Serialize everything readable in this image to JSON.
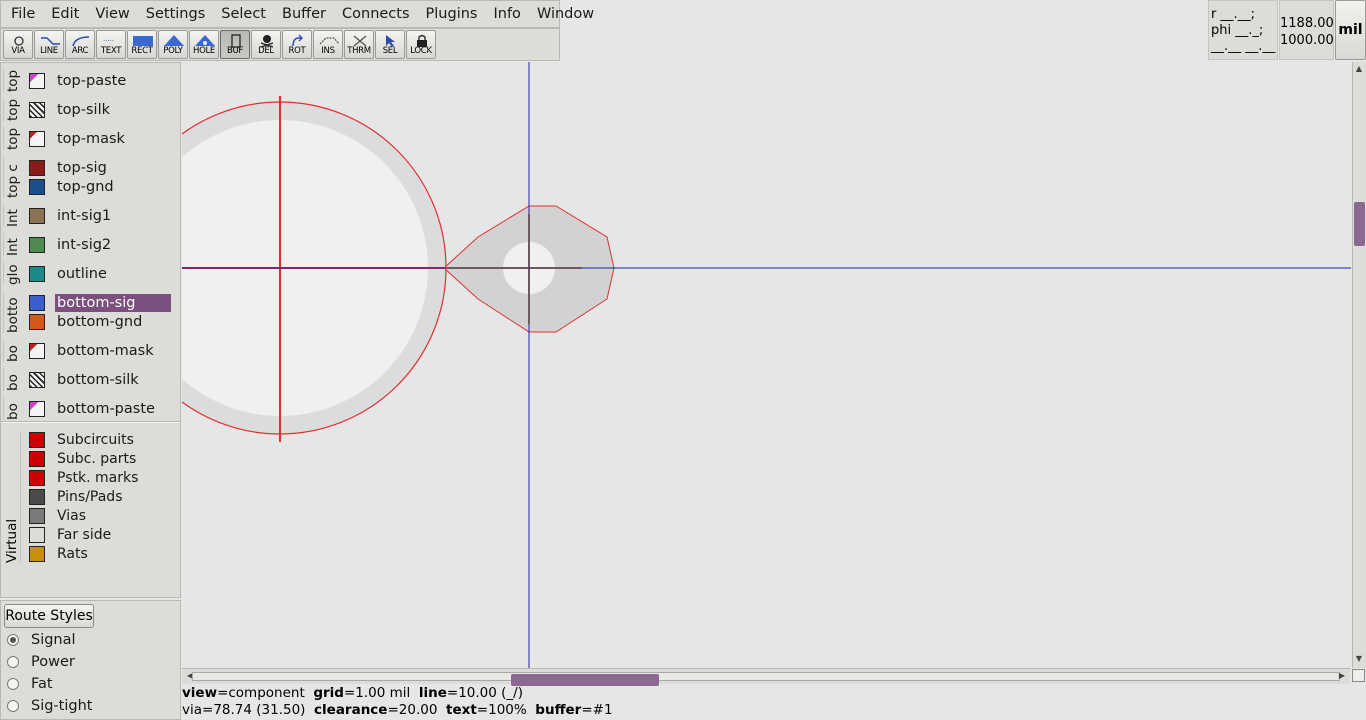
{
  "menubar": [
    "File",
    "Edit",
    "View",
    "Settings",
    "Select",
    "Buffer",
    "Connects",
    "Plugins",
    "Info",
    "Window"
  ],
  "toolbar": [
    {
      "label": "VIA",
      "icon": "via-icon",
      "active": false
    },
    {
      "label": "LINE",
      "icon": "line-icon",
      "active": false
    },
    {
      "label": "ARC",
      "icon": "arc-icon",
      "active": false
    },
    {
      "label": "TEXT",
      "icon": "text-icon",
      "active": false
    },
    {
      "label": "RECT",
      "icon": "rect-icon",
      "active": false
    },
    {
      "label": "POLY",
      "icon": "poly-icon",
      "active": false
    },
    {
      "label": "HOLE",
      "icon": "hole-icon",
      "active": false
    },
    {
      "label": "BUF",
      "icon": "buffer-icon",
      "active": true
    },
    {
      "label": "DEL",
      "icon": "delete-icon",
      "active": false
    },
    {
      "label": "ROT",
      "icon": "rotate-icon",
      "active": false
    },
    {
      "label": "INS",
      "icon": "insert-icon",
      "active": false
    },
    {
      "label": "THRM",
      "icon": "thermal-icon",
      "active": false
    },
    {
      "label": "SEL",
      "icon": "select-icon",
      "active": false
    },
    {
      "label": "LOCK",
      "icon": "lock-icon",
      "active": false
    }
  ],
  "readout": {
    "r_line": "r __.__;",
    "phi_line": "phi __._;",
    "blank_line": "__.__ __.__",
    "x": "1188.00",
    "y": "1000.00",
    "unit": "mil"
  },
  "layer_groups": [
    {
      "label": "top"
    },
    {
      "label": "top"
    },
    {
      "label": "top"
    },
    {
      "label": "top c"
    },
    {
      "label": "Int"
    },
    {
      "label": "Int"
    },
    {
      "label": "glo"
    },
    {
      "label": "botto"
    },
    {
      "label": "bo"
    },
    {
      "label": "bo"
    },
    {
      "label": "bo"
    }
  ],
  "layers": [
    {
      "name": "top-paste",
      "color": "paste"
    },
    {
      "name": "top-silk",
      "color": "hatch"
    },
    {
      "name": "top-mask",
      "color": "mask"
    },
    {
      "name": "top-sig",
      "color": "#8b1a1a"
    },
    {
      "name": "top-gnd",
      "color": "#1a4f8b"
    },
    {
      "name": "int-sig1",
      "color": "#8b7355"
    },
    {
      "name": "int-sig2",
      "color": "#4f8b4f"
    },
    {
      "name": "outline",
      "color": "#1a8b8b"
    },
    {
      "name": "bottom-sig",
      "color": "#3a5fcd",
      "selected": true
    },
    {
      "name": "bottom-gnd",
      "color": "#d45a1a"
    },
    {
      "name": "bottom-mask",
      "color": "mask"
    },
    {
      "name": "bottom-silk",
      "color": "hatch"
    },
    {
      "name": "bottom-paste",
      "color": "paste"
    }
  ],
  "virtual": {
    "label": "Virtual",
    "items": [
      {
        "name": "Subcircuits",
        "color": "#cc0000"
      },
      {
        "name": "Subc. parts",
        "color": "#cc0000"
      },
      {
        "name": "Pstk. marks",
        "color": "#cc0000"
      },
      {
        "name": "Pins/Pads",
        "color": "#4a4a4a"
      },
      {
        "name": "Vias",
        "color": "#7a7a7a"
      },
      {
        "name": "Far side",
        "color": "#dcdcd8"
      },
      {
        "name": "Rats",
        "color": "#c8900a"
      }
    ]
  },
  "route_styles": {
    "button": "Route Styles",
    "options": [
      {
        "label": "Signal",
        "checked": true
      },
      {
        "label": "Power",
        "checked": false
      },
      {
        "label": "Fat",
        "checked": false
      },
      {
        "label": "Sig-tight",
        "checked": false
      }
    ]
  },
  "status": {
    "line1": [
      {
        "k": "view",
        "v": "=component  "
      },
      {
        "k": "grid",
        "v": "=1.00 mil  "
      },
      {
        "k": "line",
        "v": "=10.00 (_/)"
      }
    ],
    "line2": [
      {
        "k": "",
        "v": "via=78.74 (31.50)  "
      },
      {
        "k": "clearance",
        "v": "=20.00  "
      },
      {
        "k": "text",
        "v": "=100%  "
      },
      {
        "k": "buffer",
        "v": "=#1"
      }
    ]
  },
  "colors": {
    "crosshair": "#2020a0",
    "outline": "#e03030",
    "pad_fill": "#d2d2d2",
    "big_pad_fill": "#f0f0f0",
    "selection": "#7b4f7e"
  }
}
